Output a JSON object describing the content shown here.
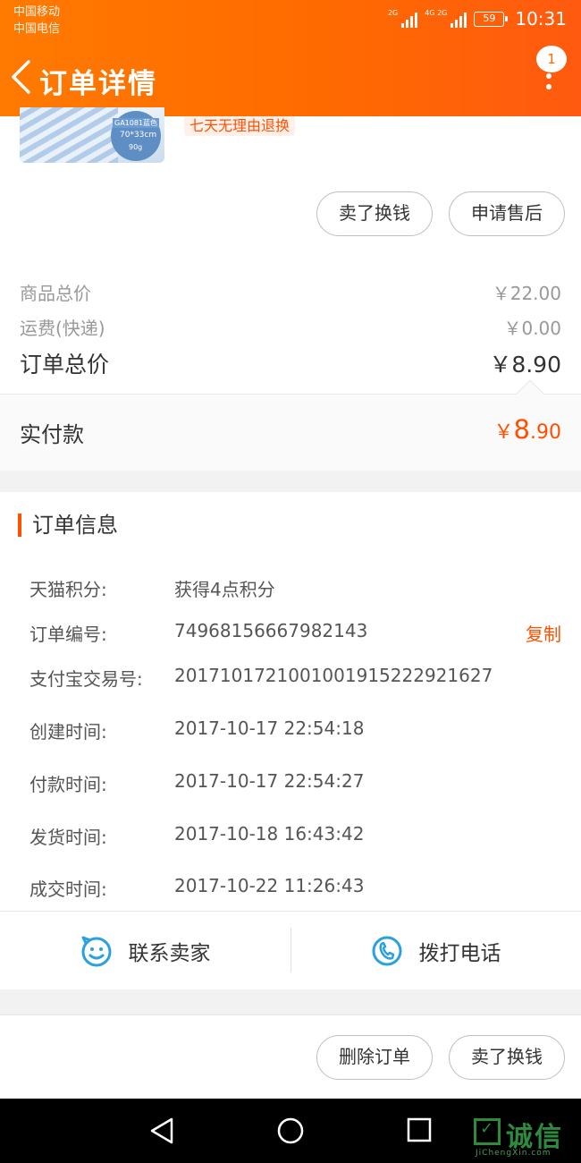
{
  "status_bar": {
    "carrier1": "中国移动",
    "carrier2": "中国电信",
    "sig1_tag": "2G",
    "sig2_tag": "4G 2G",
    "battery": "59",
    "time": "10:31"
  },
  "header": {
    "title": "订单详情",
    "badge": "1",
    "back_icon": "chevron-left-icon",
    "more_icon": "more-vertical-icon"
  },
  "product": {
    "thumb_code": "GA1081蓝色",
    "thumb_size": "70*33cm",
    "thumb_weight": "90g",
    "return_tag": "七天无理由退换",
    "buttons": [
      "卖了换钱",
      "申请售后"
    ]
  },
  "prices": {
    "goods_label": "商品总价",
    "goods_value": "￥22.00",
    "shipping_label": "运费(快递)",
    "shipping_value": "￥0.00",
    "total_label": "订单总价",
    "total_value": "￥8.90",
    "paid_label": "实付款",
    "paid_currency": "￥",
    "paid_int": "8",
    "paid_dec": ".90"
  },
  "order_info": {
    "title": "订单信息",
    "rows": [
      {
        "label": "天猫积分:",
        "value": "获得4点积分"
      },
      {
        "label": "订单编号:",
        "value": "74968156667982143",
        "action": "复制"
      },
      {
        "label": "支付宝交易号:",
        "value": "2017101721001001915222921627"
      },
      {
        "label": "创建时间:",
        "value": "2017-10-17 22:54:18"
      },
      {
        "label": "付款时间:",
        "value": "2017-10-17 22:54:27"
      },
      {
        "label": "发货时间:",
        "value": "2017-10-18 16:43:42"
      },
      {
        "label": "成交时间:",
        "value": "2017-10-22 11:26:43"
      }
    ]
  },
  "contact": {
    "seller": "联系卖家",
    "seller_icon": "smiley-chat-icon",
    "call": "拨打电话",
    "call_icon": "phone-icon"
  },
  "actions": {
    "buttons": [
      "删除订单",
      "卖了换钱"
    ]
  },
  "watermark": {
    "text": "诚信",
    "sub": "JiChengXin.com"
  },
  "colors": {
    "accent": "#ff5000",
    "header_start": "#ff7a00",
    "header_end": "#ff5a10",
    "icon_blue": "#29a1e0"
  }
}
